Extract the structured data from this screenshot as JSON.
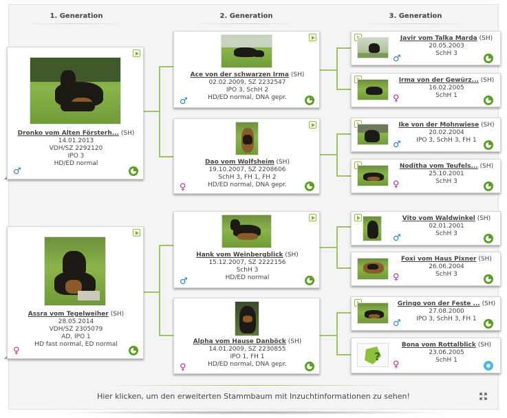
{
  "headers": [
    "1. Generation",
    "2. Generation",
    "3. Generation"
  ],
  "gen1": [
    {
      "name": "Dronko vom Alten Försterh...",
      "reg": "(SH)",
      "lines": [
        "14.01.2013",
        "VDH/SZ 2292120",
        "IPO 3",
        "HD/ED normal"
      ],
      "sex": "♂"
    },
    {
      "name": "Assra vom Tegelweiher",
      "reg": "(SH)",
      "lines": [
        "28.05.2014",
        "VDH/SZ 2305079",
        "AD, IPO 1",
        "HD fast normal, ED normal"
      ],
      "sex": "♀"
    }
  ],
  "gen2": [
    {
      "name": "Ace von der schwarzen Irma",
      "reg": "(SH)",
      "lines": [
        "02.02.2009, SZ 2232547",
        "IPO 3, SchH 2",
        "HD/ED normal, DNA gepr."
      ],
      "sex": "♂"
    },
    {
      "name": "Dao vom Wolfsheim",
      "reg": "(SH)",
      "lines": [
        "19.10.2007, SZ 2208606",
        "SchH 3, FH 1, FH 2",
        "HD/ED normal, DNA gepr."
      ],
      "sex": "♀"
    },
    {
      "name": "Hank vom Weinbergblick",
      "reg": "(SH)",
      "lines": [
        "15.12.2007, SZ 2222156",
        "SchH 3",
        "HD/ED normal"
      ],
      "sex": "♂"
    },
    {
      "name": "Alpha vom Hause Danböck",
      "reg": "(SH)",
      "lines": [
        "14.01.2009, SZ 2230855",
        "IPO 1, FH 1",
        "HD/ED normal, DNA gepr."
      ],
      "sex": "♀"
    }
  ],
  "gen3": [
    {
      "name": "Javir vom Talka Marda",
      "reg": "(SH)",
      "lines": [
        "20.05.2003",
        "SchH 3"
      ],
      "sex": "♂"
    },
    {
      "name": "Irma von der Gewürz...",
      "reg": "(SH)",
      "lines": [
        "16.02.2005",
        "SchH 1"
      ],
      "sex": "♀"
    },
    {
      "name": "Ike von der Mohnwiese",
      "reg": "(SH)",
      "lines": [
        "20.02.2004",
        "IPO 3, SchH 3, FH 1"
      ],
      "sex": "♂"
    },
    {
      "name": "Noditha vom Teufels...",
      "reg": "(SH)",
      "lines": [
        "25.10.2001",
        "SchH 3"
      ],
      "sex": "♀"
    },
    {
      "name": "Vito vom Waldwinkel",
      "reg": "(SH)",
      "lines": [
        "02.01.2001",
        "SchH 3"
      ],
      "sex": "♂"
    },
    {
      "name": "Foxi vom Haus Pixner",
      "reg": "(SH)",
      "lines": [
        "26.06.2004",
        "SchH 3"
      ],
      "sex": "♀"
    },
    {
      "name": "Gringo von der Feste ...",
      "reg": "(SH)",
      "lines": [
        "27.08.2000",
        "IPO 3, SchH 3, FH 1"
      ],
      "sex": "♂"
    },
    {
      "name": "Bona vom Rottalblick",
      "reg": "(SH)",
      "lines": [
        "23.06.2005",
        "SchH 1"
      ],
      "sex": "♀"
    }
  ],
  "footer": {
    "link": "Hier klicken, um den erweiterten Stammbaum mit Inzuchtinformationen zu sehen!"
  },
  "colors": {
    "accent": "#8fc03c",
    "male": "#2a7bb5",
    "female": "#b02d9a"
  }
}
